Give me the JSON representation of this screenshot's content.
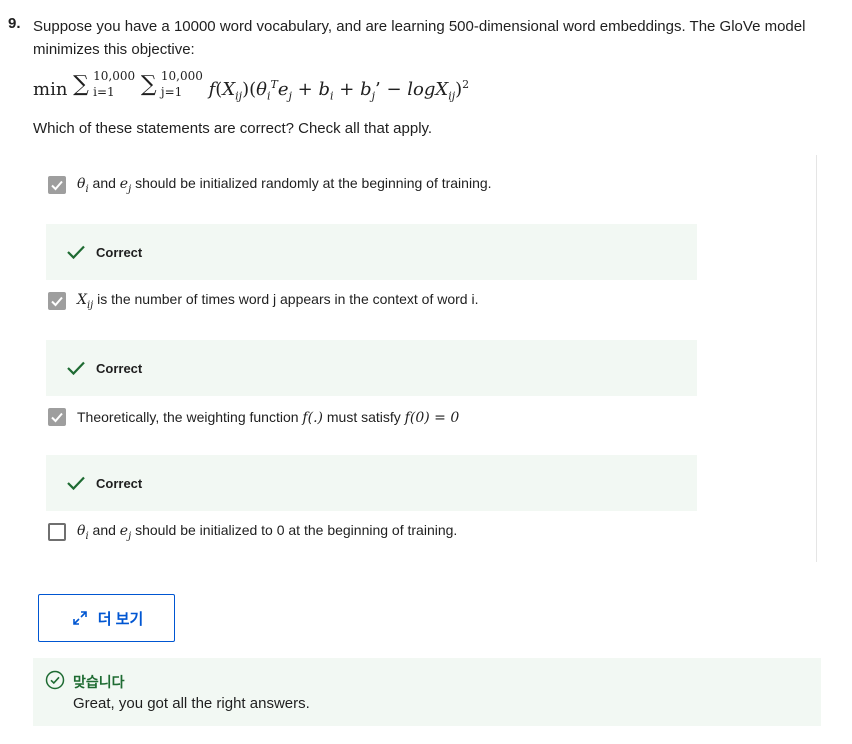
{
  "question": {
    "number": "9.",
    "text": "Suppose you have a 10000 word vocabulary, and are learning 500-dimensional word embeddings. The GloVe model minimizes this objective:",
    "formula": {
      "min": "min",
      "sum_upper": "10,000",
      "sum1_lower": "i=1",
      "sum2_lower": "j=1",
      "body": "f(X",
      "exponent": "2"
    },
    "prompt": "Which of these statements are correct? Check all that apply."
  },
  "options": [
    {
      "text": "θ_i and e_j should be initialized randomly at the beginning of training.",
      "checked": true,
      "feedback": "Correct"
    },
    {
      "text": "X_ij is the number of times word j appears in the context of word i.",
      "checked": true,
      "feedback": "Correct"
    },
    {
      "text": "Theoretically, the weighting function f(.) must satisfy f(0) = 0",
      "checked": true,
      "feedback": "Correct"
    },
    {
      "text": "θ_i and e_j should be initialized to 0 at the beginning of training.",
      "checked": false,
      "feedback": ""
    }
  ],
  "option_parts": {
    "opt1": {
      "mid": " and ",
      "rest": " should be initialized randomly at the beginning of training."
    },
    "opt2": {
      "rest": " is the number of times word j appears in the context of word i."
    },
    "opt3": {
      "pre": "Theoretically, the weighting function ",
      "f1": "f(.)",
      "mid": " must satisfy ",
      "f2": "f(0) = 0"
    },
    "opt4": {
      "mid": " and ",
      "rest": " should be initialized to 0 at the beginning of training."
    }
  },
  "more_button": {
    "label": "더 보기",
    "icon": "expand-arrows-icon"
  },
  "result": {
    "title": "맞습니다",
    "message": "Great, you got all the right answers.",
    "icon": "check-circle-icon"
  },
  "colors": {
    "accent": "#0056d2",
    "correct_green": "#1e6b32",
    "feedback_bg": "#f2f8f3",
    "checkbox_checked": "#9e9e9e"
  }
}
